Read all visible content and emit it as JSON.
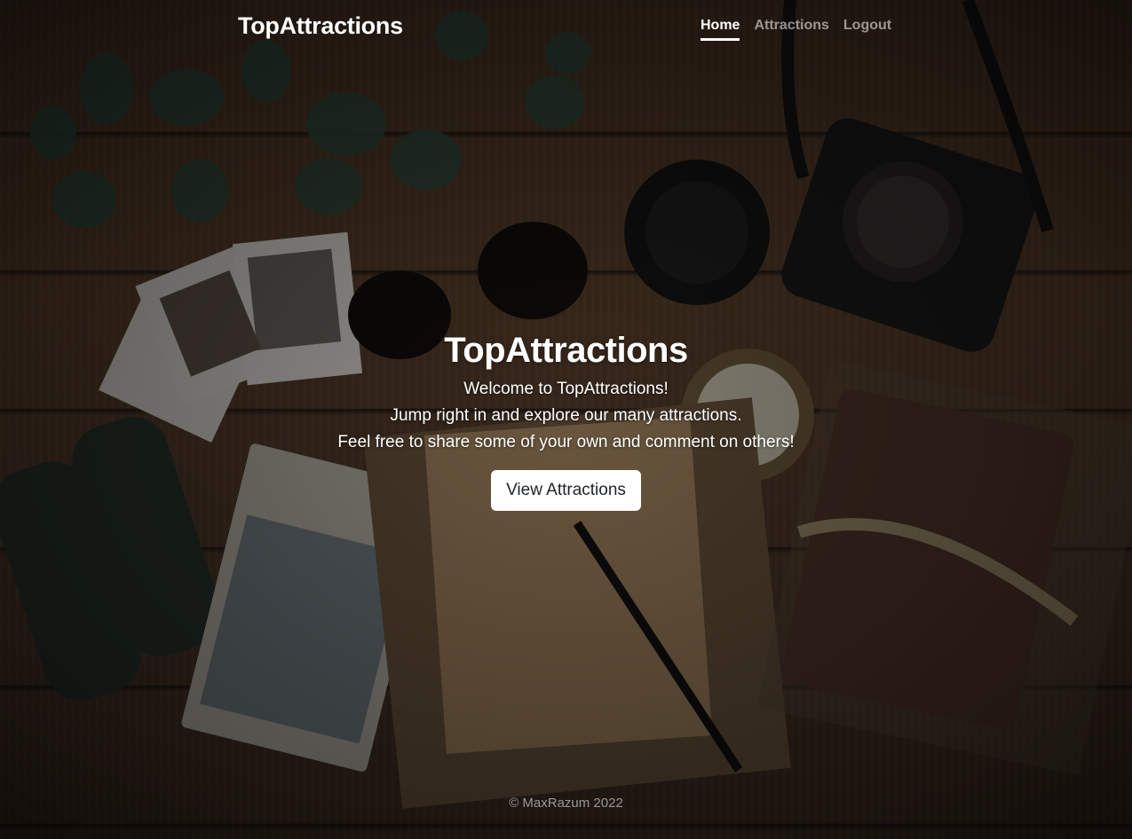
{
  "header": {
    "brand": "TopAttractions",
    "nav": [
      {
        "label": "Home",
        "active": true
      },
      {
        "label": "Attractions",
        "active": false
      },
      {
        "label": "Logout",
        "active": false
      }
    ]
  },
  "hero": {
    "title": "TopAttractions",
    "lines": [
      "Welcome to TopAttractions!",
      "Jump right in and explore our many attractions.",
      "Feel free to share some of your own and comment on others!"
    ],
    "cta_label": "View Attractions"
  },
  "footer": {
    "text": "© MaxRazum 2022"
  },
  "colors": {
    "button_bg": "#ffffff",
    "button_text": "#212529",
    "nav_inactive": "rgba(255,255,255,0.55)"
  }
}
